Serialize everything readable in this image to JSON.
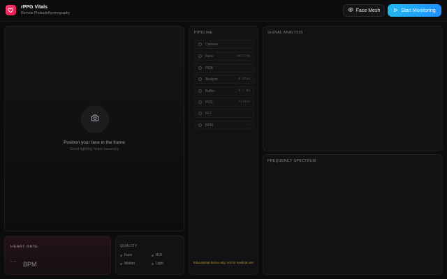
{
  "header": {
    "title": "rPPG Vitals",
    "subtitle": "Remote Photoplethysmography",
    "face_mesh_label": "Face Mesh",
    "start_label": "Start Monitoring"
  },
  "video": {
    "message": "Position your face in the frame",
    "hint": "Good lighting helps accuracy"
  },
  "heart_rate": {
    "label": "HEART RATE",
    "value": "-- --",
    "unit": "BPM"
  },
  "quality": {
    "label": "QUALITY",
    "items": [
      "Face",
      "ROI",
      "Motion",
      "Light"
    ]
  },
  "pipeline": {
    "label": "PIPELINE",
    "steps": [
      {
        "name": "Camera",
        "status": ""
      },
      {
        "name": "Face",
        "status": "waiting"
      },
      {
        "name": "RGB",
        "status": ""
      },
      {
        "name": "Analyze",
        "status": "0.0fps"
      },
      {
        "name": "Buffer",
        "status": "0 / 0s"
      },
      {
        "name": "POS",
        "status": "filter"
      },
      {
        "name": "FFT",
        "status": ""
      },
      {
        "name": "BPM",
        "status": "--"
      }
    ],
    "disclaimer": "Educational demo only, not for medical use."
  },
  "signal": {
    "label": "SIGNAL ANALYSIS"
  },
  "spectrum": {
    "label": "FREQUENCY SPECTRUM"
  },
  "colors": {
    "accent": "#1e90ff",
    "brand": "#e3194f",
    "background": "#0c0c0d",
    "warning_text": "#b59a3a"
  }
}
